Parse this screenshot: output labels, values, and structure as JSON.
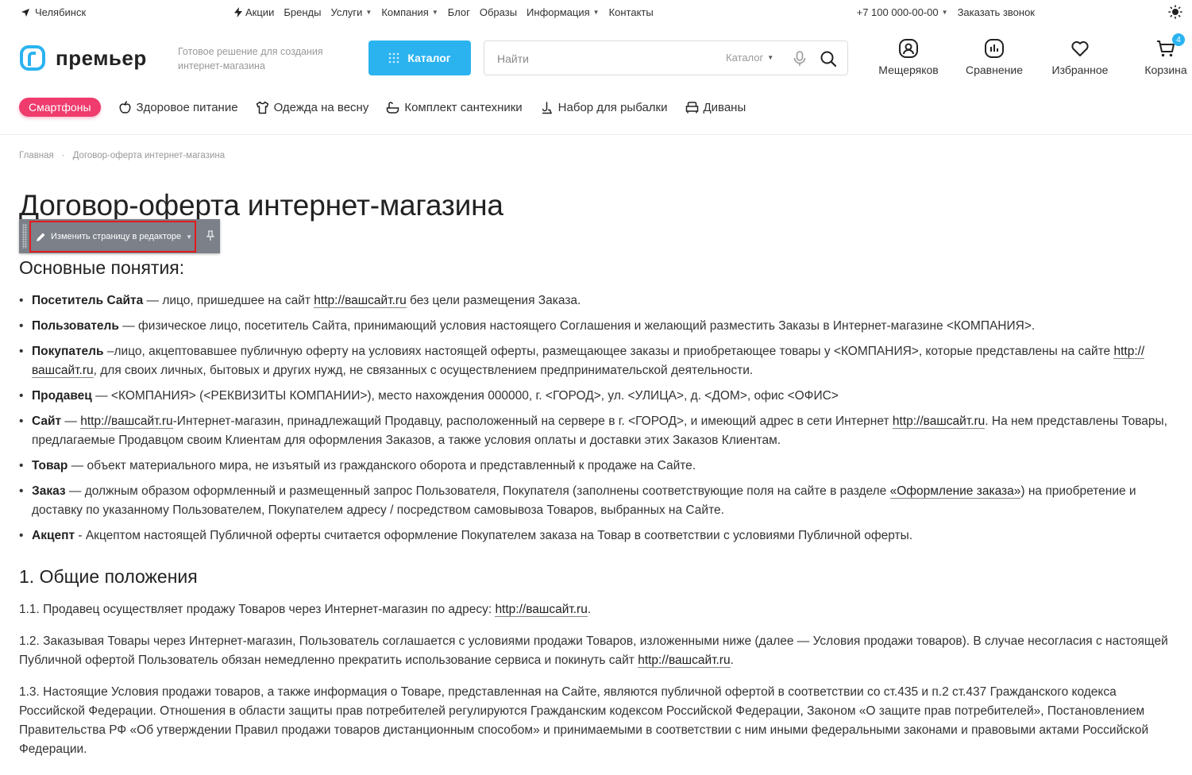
{
  "topbar": {
    "city": "Челябинск",
    "nav": [
      {
        "label": "Акции",
        "icon": "bolt-icon",
        "caret": false
      },
      {
        "label": "Бренды",
        "caret": false
      },
      {
        "label": "Услуги",
        "caret": true
      },
      {
        "label": "Компания",
        "caret": true
      },
      {
        "label": "Блог",
        "caret": false
      },
      {
        "label": "Образы",
        "caret": false
      },
      {
        "label": "Информация",
        "caret": true
      },
      {
        "label": "Контакты",
        "caret": false
      }
    ],
    "phone": "+7 100 000-00-00",
    "callback": "Заказать звонок"
  },
  "header": {
    "logo": "премьер",
    "slogan": "Готовое решение для создания интернет-магазина",
    "catalog_label": "Каталог",
    "search_placeholder": "Найти",
    "search_scope": "Каталог",
    "icons": [
      {
        "name": "profile-icon",
        "label": "Мещеряков"
      },
      {
        "name": "compare-icon",
        "label": "Сравнение"
      },
      {
        "name": "heart-icon",
        "label": "Избранное"
      },
      {
        "name": "cart-icon",
        "label": "Корзина"
      }
    ],
    "cart_count": "4",
    "accent": "#2bb3f0"
  },
  "tags": [
    "Смартфоны",
    "Здоровое питание",
    "Одежда на весну",
    "Комплект сантехники",
    "Набор для рыбалки",
    "Диваны"
  ],
  "breadcrumb": [
    "Главная",
    "Договор-оферта интернет-магазина"
  ],
  "title": "Договор-оферта интернет-магазина",
  "editor": {
    "edit_label": "Изменить страницу в редакторе"
  },
  "content": {
    "h_basic": "Основные понятия:",
    "terms": {
      "visitor": {
        "term": "Посетитель Сайта",
        "a": " — лицо, пришедшее на сайт ",
        "link": "http://вашсайт.ru",
        "b": " без цели размещения Заказа."
      },
      "user": {
        "term": "Пользователь",
        "text": " — физическое лицо, посетитель Сайта, принимающий условия настоящего Соглашения и желающий разместить Заказы в Интернет-магазине <КОМПАНИЯ>."
      },
      "buyer": {
        "term": "Покупатель",
        "a": " –лицо, акцептовавшее публичную оферту на условиях настоящей оферты, размещающее заказы и приобретающее товары у <КОМПАНИЯ>, которые представлены на сайте ",
        "link": "http://вашсайт.ru",
        "b": ", для своих личных, бытовых и других нужд, не связанных с осуществлением предпринимательской деятельности."
      },
      "seller": {
        "term": "Продавец",
        "text": " — <КОМПАНИЯ> (<РЕКВИЗИТЫ КОМПАНИИ>), место нахождения 000000, г. <ГОРОД>, ул. <УЛИЦА>, д. <ДОМ>, офис <ОФИС>"
      },
      "site": {
        "term": "Сайт",
        "a": " — ",
        "link1": "http://вашсайт.ru",
        "b": "-Интернет-магазин, принадлежащий Продавцу, расположенный на сервере в г. <ГОРОД>, и имеющий адрес в сети Интернет ",
        "link2": "http://вашсайт.ru",
        "c": ". На нем представлены Товары, предлагаемые Продавцом своим Клиентам для оформления Заказов, а также условия оплаты и доставки этих Заказов Клиентам."
      },
      "goods": {
        "term": "Товар",
        "text": " — объект материального мира, не изъятый из гражданского оборота и представленный к продаже на Сайте."
      },
      "order": {
        "term": "Заказ",
        "a": " — должным образом оформленный и размещенный запрос Пользователя, Покупателя (заполнены соответствующие поля на сайте в разделе ",
        "link": "«Оформление заказа»",
        "b": ") на приобретение и доставку по указанному Пользователем, Покупателем адресу / посредством самовывоза Товаров, выбранных на Сайте."
      },
      "accept": {
        "term": "Акцепт",
        "text": " - Акцептом настоящей Публичной оферты считается оформление Покупателем заказа на Товар в соответствии с условиями Публичной оферты."
      }
    },
    "h_general": "1. Общие положения",
    "p1": {
      "a": "1.1. Продавец осуществляет продажу Товаров через Интернет-магазин по адресу: ",
      "link": "http://вашсайт.ru",
      "b": "."
    },
    "p2": {
      "a": "1.2. Заказывая Товары через Интернет-магазин, Пользователь соглашается с условиями продажи Товаров, изложенными ниже (далее — Условия продажи товаров). В случае несогласия с настоящей Публичной офертой Пользователь обязан немедленно прекратить использование сервиса и покинуть сайт ",
      "link": "http://вашсайт.ru",
      "b": "."
    },
    "p3": "1.3. Настоящие Условия продажи товаров, а также информация о Товаре, представленная на Сайте, являются публичной офертой в соответствии со ст.435 и п.2 ст.437 Гражданского кодекса Российской Федерации. Отношения в области защиты прав потребителей регулируются Гражданским кодексом Российской Федерации, Законом «О защите прав потребителей», Постановлением Правительства РФ «Об утверждении Правил продажи товаров дистанционным способом» и принимаемыми в соответствии с ним иными федеральными законами и правовыми актами Российской Федерации."
  }
}
